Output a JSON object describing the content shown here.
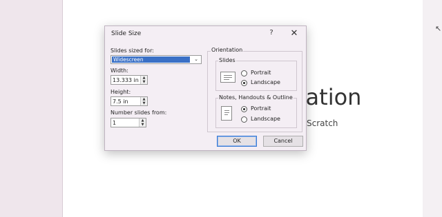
{
  "slide": {
    "title_fragment": "tation",
    "subtitle_fragment": "Scratch"
  },
  "dialog": {
    "title": "Slide Size",
    "help": "?",
    "close": "✕",
    "sized_for_label": "Slides sized for:",
    "sized_for_value": "Widescreen",
    "width_label": "Width:",
    "width_value": "13.333 in",
    "height_label": "Height:",
    "height_value": "7.5 in",
    "number_from_label": "Number slides from:",
    "number_from_value": "1",
    "orientation_label": "Orientation",
    "slides_group": {
      "label": "Slides",
      "options": [
        "Portrait",
        "Landscape"
      ],
      "selected": "Landscape"
    },
    "notes_group": {
      "label": "Notes, Handouts & Outline",
      "options": [
        "Portrait",
        "Landscape"
      ],
      "selected": "Portrait"
    },
    "ok_label": "OK",
    "cancel_label": "Cancel"
  }
}
